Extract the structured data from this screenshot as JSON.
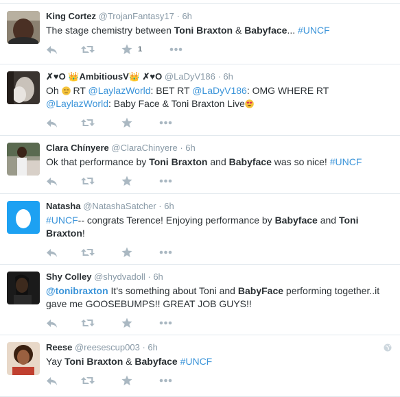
{
  "tweets": [
    {
      "fullname": "King Cortez",
      "username": "@TrojanFantasy17",
      "time": "6h",
      "text": [
        "The stage chemistry between ",
        "Toni Braxton",
        " & ",
        "Babyface",
        "... ",
        "#UNCF"
      ],
      "favorite_count": "1"
    },
    {
      "fullname": "✗♥O 👑AmbitiousV👑 ✗♥O",
      "username": "@LaDyV186",
      "time": "6h",
      "text_line1": [
        "Oh ",
        " RT ",
        "@LaylazWorld",
        ": BET RT ",
        "@LaDyV186",
        ": OMG WHERE  RT"
      ],
      "text_line2": [
        "@LaylazWorld",
        ": Baby Face & Toni Braxton Live"
      ]
    },
    {
      "fullname": "Clara Chínyere",
      "username": "@ClaraChinyere",
      "time": "6h",
      "text": [
        "Ok that performance by ",
        "Toni Braxton",
        " and ",
        "Babyface",
        " was so nice! ",
        "#UNCF"
      ]
    },
    {
      "fullname": "Natasha",
      "username": "@NatashaSatcher",
      "time": "6h",
      "text": [
        "#UNCF",
        "-- congrats Terence! Enjoying performance by ",
        "Babyface",
        " and ",
        "Toni",
        "Braxton",
        "!"
      ]
    },
    {
      "fullname": "Shy Colley",
      "username": "@shydvadoll",
      "time": "6h",
      "text": [
        "@tonibraxton",
        " It's something about Toni and ",
        "BabyFace",
        " performing together..it",
        "gave me GOOSEBUMPS!! GREAT JOB GUYS!!"
      ]
    },
    {
      "fullname": "Reese",
      "username": "@reesescup003",
      "time": "6h",
      "text": [
        "Yay ",
        "Toni Braxton",
        " & ",
        "Babyface",
        " ",
        "#UNCF"
      ]
    }
  ],
  "colors": {
    "link": "#3b94d9",
    "meta": "#8899a6",
    "icon": "#aab8c2",
    "divider": "#e1e8ed"
  },
  "icons": [
    "reply-icon",
    "retweet-icon",
    "favorite-icon",
    "more-icon",
    "egg-avatar-icon",
    "globe-icon"
  ]
}
